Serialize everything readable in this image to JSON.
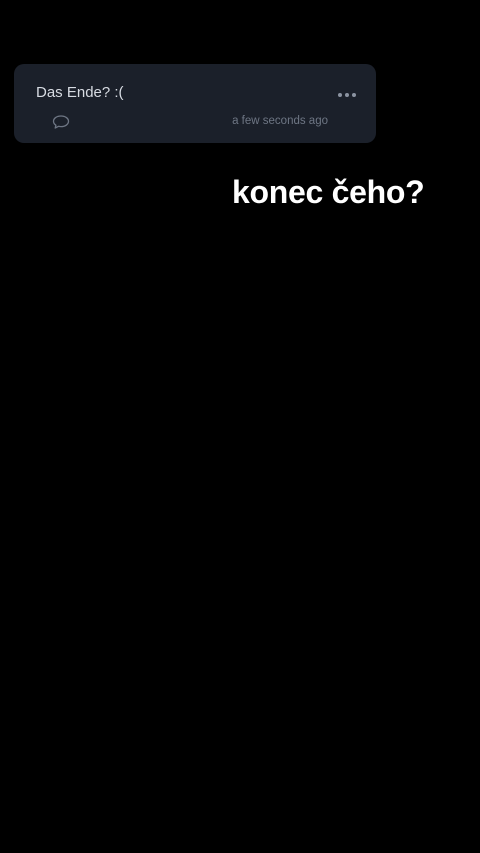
{
  "post": {
    "text": "Das Ende? :(",
    "timestamp": "a few seconds ago",
    "icons": {
      "comment": "speech-bubble-icon",
      "more": "ellipsis-icon"
    }
  },
  "overlay": {
    "caption": "konec čeho?"
  },
  "colors": {
    "background": "#000000",
    "card": "#1b202a",
    "text": "#d7dbe2",
    "muted": "#6e7684",
    "caption": "#ffffff"
  }
}
